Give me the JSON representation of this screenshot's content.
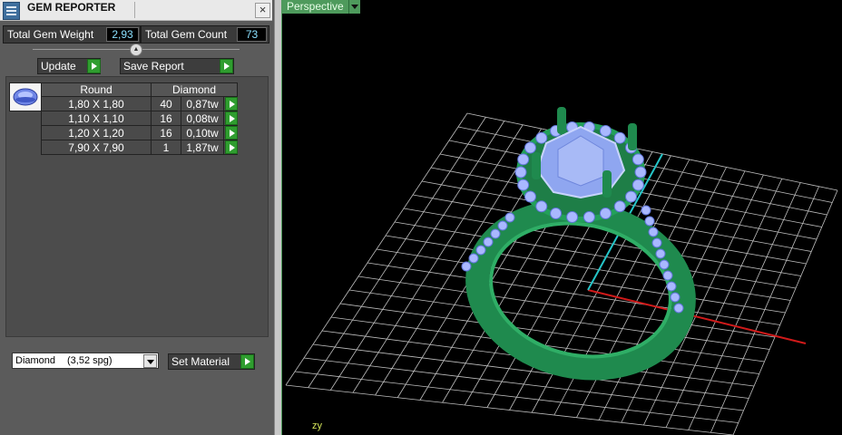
{
  "window": {
    "title": "GEM REPORTER",
    "close": "×"
  },
  "stats": {
    "weight_label": "Total Gem Weight",
    "weight_value": "2,93",
    "count_label": "Total Gem Count",
    "count_value": "73"
  },
  "buttons": {
    "update": "Update",
    "save_report": "Save Report",
    "set_material": "Set Material"
  },
  "table": {
    "col_shape": "Round",
    "col_material": "Diamond",
    "rows": [
      {
        "size": "1,80 X 1,80",
        "count": "40",
        "weight": "0,87tw"
      },
      {
        "size": "1,10 X 1,10",
        "count": "16",
        "weight": "0,08tw"
      },
      {
        "size": "1,20 X 1,20",
        "count": "16",
        "weight": "0,10tw"
      },
      {
        "size": "7,90 X 7,90",
        "count": "1",
        "weight": "1,87tw"
      }
    ]
  },
  "material": {
    "name": "Diamond",
    "spg": "(3,52 spg)"
  },
  "viewport": {
    "view_name": "Perspective",
    "axis_z": "z",
    "axis_y": "y"
  },
  "colors": {
    "accent_green": "#2f9d2f",
    "ring_green": "#1f8a4e",
    "gem_blue": "#8fa6f0",
    "grid": "#bfbfbf",
    "x_axis": "#d01a1a",
    "y_axis": "#25c5c8"
  }
}
